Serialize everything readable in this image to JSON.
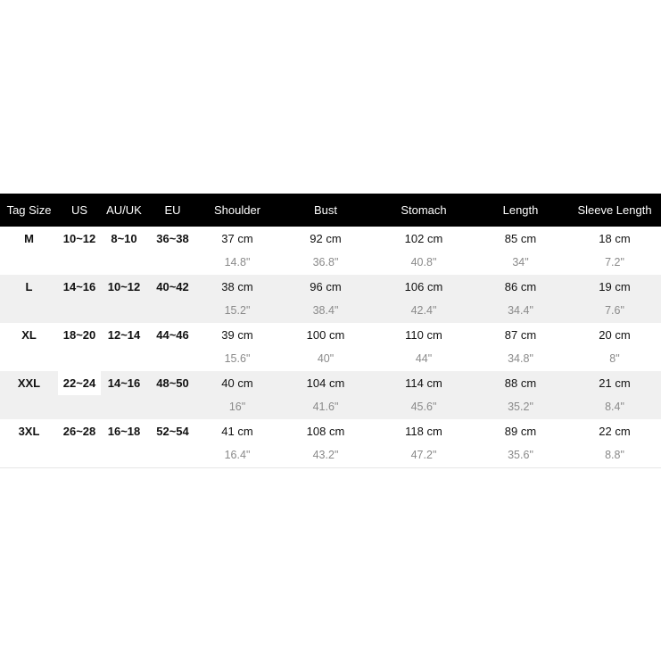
{
  "headers": [
    "Tag Size",
    "US",
    "AU/UK",
    "EU",
    "Shoulder",
    "Bust",
    "Stomach",
    "Length",
    "Sleeve Length"
  ],
  "rows": [
    {
      "tag": "M",
      "us": "10~12",
      "auuk": "8~10",
      "eu": "36~38",
      "shoulder": [
        "37 cm",
        "14.8\""
      ],
      "bust": [
        "92 cm",
        "36.8\""
      ],
      "stomach": [
        "102 cm",
        "40.8\""
      ],
      "length": [
        "85 cm",
        "34\""
      ],
      "sleeve": [
        "18 cm",
        "7.2\""
      ]
    },
    {
      "tag": "L",
      "us": "14~16",
      "auuk": "10~12",
      "eu": "40~42",
      "shoulder": [
        "38 cm",
        "15.2\""
      ],
      "bust": [
        "96 cm",
        "38.4\""
      ],
      "stomach": [
        "106 cm",
        "42.4\""
      ],
      "length": [
        "86 cm",
        "34.4\""
      ],
      "sleeve": [
        "19 cm",
        "7.6\""
      ]
    },
    {
      "tag": "XL",
      "us": "18~20",
      "auuk": "12~14",
      "eu": "44~46",
      "shoulder": [
        "39 cm",
        "15.6\""
      ],
      "bust": [
        "100 cm",
        "40\""
      ],
      "stomach": [
        "110 cm",
        "44\""
      ],
      "length": [
        "87 cm",
        "34.8\""
      ],
      "sleeve": [
        "20 cm",
        "8\""
      ]
    },
    {
      "tag": "XXL",
      "us": "22~24",
      "auuk": "14~16",
      "eu": "48~50",
      "shoulder": [
        "40 cm",
        "16\""
      ],
      "bust": [
        "104 cm",
        "41.6\""
      ],
      "stomach": [
        "114 cm",
        "45.6\""
      ],
      "length": [
        "88 cm",
        "35.2\""
      ],
      "sleeve": [
        "21 cm",
        "8.4\""
      ]
    },
    {
      "tag": "3XL",
      "us": "26~28",
      "auuk": "16~18",
      "eu": "52~54",
      "shoulder": [
        "41 cm",
        "16.4\""
      ],
      "bust": [
        "108 cm",
        "43.2\""
      ],
      "stomach": [
        "118 cm",
        "47.2\""
      ],
      "length": [
        "89 cm",
        "35.6\""
      ],
      "sleeve": [
        "22 cm",
        "8.8\""
      ]
    }
  ],
  "colors": {
    "header_bg": "#000000",
    "header_text": "#ffffff",
    "alt_row": "#f0f0f0",
    "inch_text": "#8a8a8a"
  }
}
